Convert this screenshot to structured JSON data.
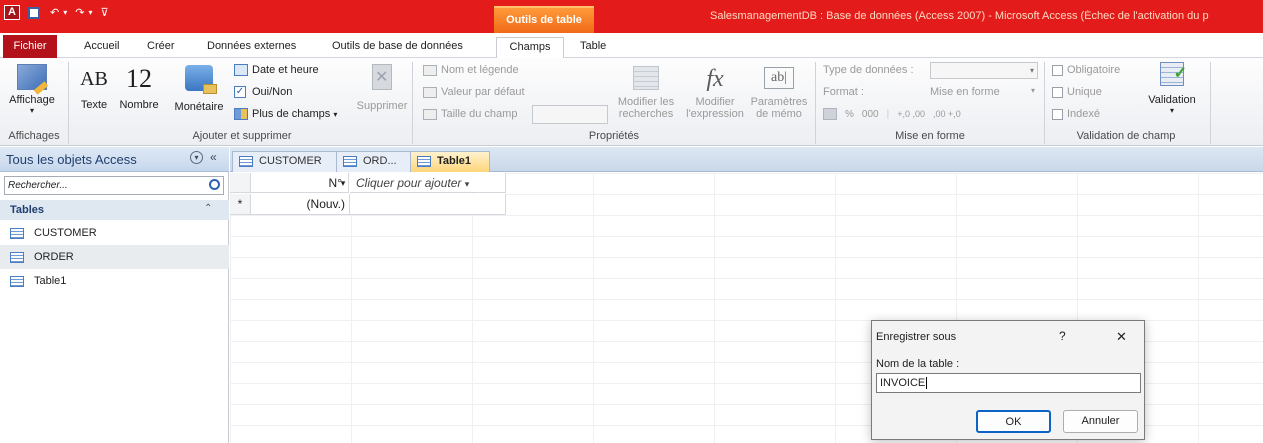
{
  "titlebar": {
    "app_icon_letter": "A",
    "context_tab": "Outils de table",
    "window_title": "SalesmanagementDB : Base de données (Access 2007) - Microsoft Access (Échec de l'activation du p"
  },
  "menu_tabs": [
    "Fichier",
    "Accueil",
    "Créer",
    "Données externes",
    "Outils de base de données",
    "Champs",
    "Table"
  ],
  "ribbon": {
    "views": {
      "affichage": "Affichage",
      "group": "Affichages"
    },
    "add_delete": {
      "text": "Texte",
      "number": "Nombre",
      "currency": "Monétaire",
      "text_icon": "AB",
      "number_icon": "12",
      "date_time": "Date et heure",
      "yes_no": "Oui/Non",
      "more_fields": "Plus de champs",
      "delete": "Supprimer",
      "group": "Ajouter et supprimer"
    },
    "properties": {
      "name_caption": "Nom et légende",
      "default_value": "Valeur par défaut",
      "field_size": "Taille du champ",
      "modify_lookups_1": "Modifier les",
      "modify_lookups_2": "recherches",
      "modify_expr_1": "Modifier",
      "modify_expr_2": "l'expression",
      "memo_1": "Paramètres",
      "memo_2": "de mémo",
      "fx_icon": "fx",
      "memo_icon": "ab|",
      "group": "Propriétés"
    },
    "formatting": {
      "data_type": "Type de données :",
      "format": "Format :",
      "format_value": "Mise en forme",
      "percent": "%",
      "thousands": "000",
      "dec_inc": "+,0 ,00",
      "dec_dec": ",00 +,0",
      "group": "Mise en forme"
    },
    "validation": {
      "required": "Obligatoire",
      "unique": "Unique",
      "indexed": "Indexé",
      "validation": "Validation",
      "group": "Validation de champ"
    }
  },
  "nav": {
    "title": "Tous les objets Access",
    "search_placeholder": "Rechercher...",
    "section": "Tables",
    "items": [
      "CUSTOMER",
      "ORDER",
      "Table1"
    ]
  },
  "doc_tabs": [
    "CUSTOMER",
    "ORD...",
    "Table1"
  ],
  "datasheet": {
    "col1": "N°",
    "col2": "Cliquer pour ajouter",
    "new_row_marker": "*",
    "new_row_value": "(Nouv.)"
  },
  "dialog": {
    "title": "Enregistrer sous",
    "help": "?",
    "close": "✕",
    "label": "Nom de la table :",
    "input_value": "INVOICE",
    "ok": "OK",
    "cancel": "Annuler"
  }
}
